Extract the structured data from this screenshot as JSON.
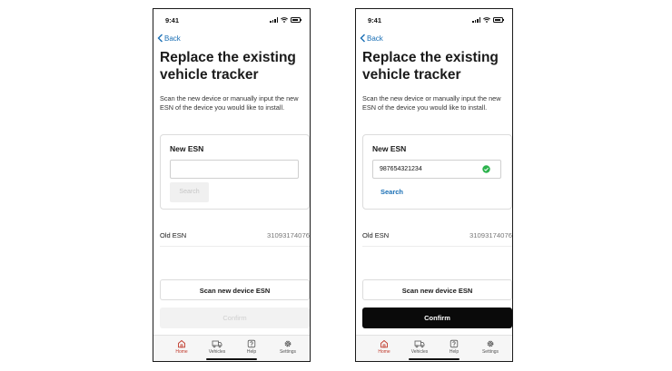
{
  "screens": [
    {
      "status_time": "9:41",
      "back_label": "Back",
      "title": "Replace the existing vehicle tracker",
      "description": "Scan the new device or manually input the new ESN of the device you would like to install.",
      "new_esn_label": "New ESN",
      "new_esn_value": "",
      "new_esn_valid": false,
      "search_label": "Search",
      "search_enabled": false,
      "old_esn_label": "Old ESN",
      "old_esn_value": "31093174076",
      "scan_button_label": "Scan new device ESN",
      "confirm_button_label": "Confirm",
      "confirm_enabled": false
    },
    {
      "status_time": "9:41",
      "back_label": "Back",
      "title": "Replace the existing vehicle tracker",
      "description": "Scan the new device or manually input the new ESN of the device you would like to install.",
      "new_esn_label": "New ESN",
      "new_esn_value": "987654321234",
      "new_esn_valid": true,
      "search_label": "Search",
      "search_enabled": true,
      "old_esn_label": "Old ESN",
      "old_esn_value": "31093174076",
      "scan_button_label": "Scan new device ESN",
      "confirm_button_label": "Confirm",
      "confirm_enabled": true
    }
  ],
  "tabs": [
    {
      "label": "Home",
      "icon": "home-icon",
      "active": true
    },
    {
      "label": "Vehicles",
      "icon": "truck-icon",
      "active": false
    },
    {
      "label": "Help",
      "icon": "help-icon",
      "active": false
    },
    {
      "label": "Settings",
      "icon": "gear-icon",
      "active": false
    }
  ],
  "colors": {
    "link": "#1a6fb5",
    "active_tab": "#c0392b",
    "valid_check": "#2bb24c",
    "confirm_active_bg": "#0a0a0a"
  }
}
